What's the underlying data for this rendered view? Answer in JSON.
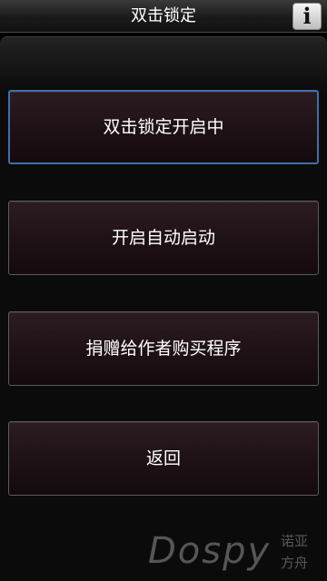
{
  "title_bar": {
    "title": "双击锁定",
    "info_icon": "info-icon",
    "info_glyph": "i"
  },
  "menu": {
    "items": [
      {
        "label": "双击锁定开启中",
        "selected": true
      },
      {
        "label": "开启自动启动",
        "selected": false
      },
      {
        "label": "捐赠给作者购买程序",
        "selected": false
      },
      {
        "label": "返回",
        "selected": false
      }
    ]
  },
  "watermark": {
    "logo_text": "Dospy",
    "sub_line_1": "诺亚",
    "sub_line_2": "方舟"
  },
  "colors": {
    "selected_border": "#3f6faa",
    "button_fill": "#1f1216",
    "background": "#000000"
  }
}
